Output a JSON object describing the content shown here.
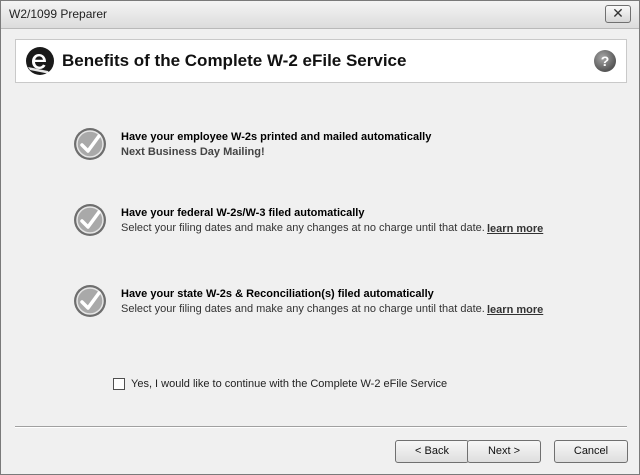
{
  "window": {
    "title": "W2/1099 Preparer",
    "close_label": "✕"
  },
  "header": {
    "title": "Benefits of the Complete W-2 eFile Service",
    "help_label": "?"
  },
  "benefits": [
    {
      "title": "Have your employee W-2s printed and mailed automatically",
      "subtitle": "Next Business Day Mailing!"
    },
    {
      "title": "Have your federal W-2s/W-3 filed automatically",
      "subtitle": "Select your filing dates and make any changes at no charge until that date.",
      "link": "learn more"
    },
    {
      "title": "Have your state W-2s & Reconciliation(s) filed automatically",
      "subtitle": "Select your filing dates and make any changes at no charge until that date.",
      "link": "learn more"
    }
  ],
  "opt_in": {
    "label": "Yes, I would like to continue with the Complete W-2 eFile Service",
    "checked": false
  },
  "buttons": {
    "back": "< Back",
    "next": "Next >",
    "cancel": "Cancel"
  }
}
